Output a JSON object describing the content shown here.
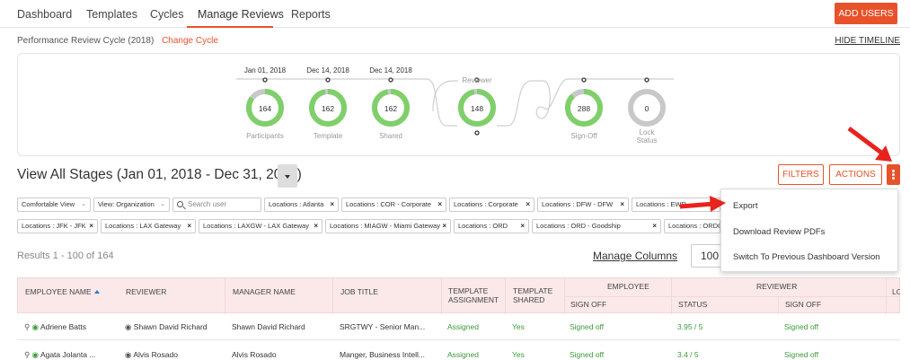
{
  "nav": {
    "tabs": [
      "Dashboard",
      "Templates",
      "Cycles",
      "Manage Reviews",
      "Reports"
    ],
    "active": "Manage Reviews",
    "add_users": "ADD USERS"
  },
  "cycle": {
    "label": "Performance Review Cycle (2018)",
    "change": "Change Cycle",
    "hide_timeline": "HIDE TIMELINE"
  },
  "timeline": {
    "dates": [
      "Jan 01, 2018",
      "Dec 14, 2018",
      "Dec 14, 2018"
    ],
    "reviewer_label": "Reviewer",
    "stages": [
      {
        "label": "Participants",
        "value": "164",
        "progress": 0.85
      },
      {
        "label": "Template",
        "value": "162",
        "progress": 0.97
      },
      {
        "label": "Shared",
        "value": "162",
        "progress": 0.97
      },
      {
        "label": "",
        "value": "148",
        "progress": 0.97
      },
      {
        "label": "Sign-Off",
        "value": "288",
        "progress": 0.88
      },
      {
        "label": "Lock Status",
        "value": "0",
        "progress": 0
      }
    ],
    "colors": {
      "done": "#7fcf6a",
      "pending": "#c8c8c8"
    }
  },
  "stage": {
    "title": "View All Stages (Jan 01, 2018 - Dec 31, 2018)",
    "filters": "FILTERS",
    "actions": "ACTIONS"
  },
  "filters": {
    "view1": "Comfortable View",
    "view2": "View: Organization",
    "search_placeholder": "Search user",
    "chips_row1": [
      "Locations : Atlanta",
      "Locations : COR - Corporate",
      "Locations : Corporate",
      "Locations : DFW - DFW",
      "Locations : EWR"
    ],
    "chips_row2": [
      "Locations : JFK - JFK",
      "Locations : LAX Gateway",
      "Locations : LAXGW - LAX Gateway",
      "Locations : MIAGW - Miami Gateway",
      "Locations : ORD",
      "Locations : ORD - Goodship",
      "Locations : ORDGW - ORD"
    ]
  },
  "results": {
    "text": "Results 1 - 100 of 164",
    "manage_columns": "Manage Columns",
    "per_page": "100"
  },
  "table": {
    "headers": {
      "employee_name": "EMPLOYEE NAME",
      "reviewer": "REVIEWER",
      "manager_name": "MANAGER NAME",
      "job_title": "JOB TITLE",
      "template_assignment": "TEMPLATE ASSIGNMENT",
      "template_shared": "TEMPLATE SHARED",
      "employee_group": "EMPLOYEE",
      "reviewer_group": "REVIEWER",
      "sign_off": "SIGN OFF",
      "status": "STATUS",
      "reviewer_sign_off": "SIGN OFF",
      "cut": "LO"
    },
    "rows": [
      {
        "employee": "Adriene Batts",
        "reviewer": "Shawn David Richard",
        "manager": "Shawn David Richard",
        "job": "SRGTWY - Senior Man...",
        "assignment": "Assigned",
        "shared": "Yes",
        "emp_sign": "Signed off",
        "status": "3.95 / 5",
        "rev_sign": "Signed off"
      },
      {
        "employee": "Agata Jolanta ...",
        "reviewer": "Alvis Rosado",
        "manager": "Alvis Rosado",
        "job": "Manger, Business Intell...",
        "assignment": "Assigned",
        "shared": "Yes",
        "emp_sign": "Signed off",
        "status": "3.4 / 5",
        "rev_sign": "Signed off"
      }
    ]
  },
  "menu": {
    "items": [
      "Export",
      "Download Review PDFs",
      "Switch To Previous Dashboard Version"
    ]
  }
}
